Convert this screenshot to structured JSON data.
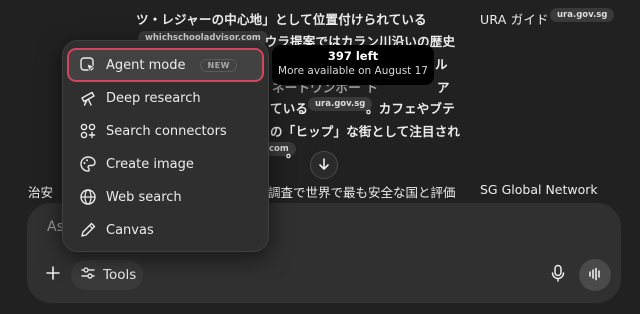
{
  "background": {
    "lines": [
      "ツ・レジャーの中心地」として位置付けられている",
      "。ウラ提案ではカラン川沿いの歴史",
      "ル",
      "ネートワンボー ト",
      "ア",
      "ている",
      "。カフェやブテ",
      "の「ヒップ」な街として注目され",
      "。"
    ],
    "chips": [
      "whichschooladvisor.com",
      "ura.gov.sg",
      "ura.gov.sg",
      "com"
    ],
    "right_source_label": "URA ガイド",
    "table_headers": [
      "治安",
      "調査で世界で最も安全な国と評価",
      "SG Global Network"
    ]
  },
  "tooltip": {
    "count_text": "397 left",
    "more_text": "More available on August 17"
  },
  "menu": {
    "items": [
      {
        "label": "Agent mode",
        "icon": "agent-mode-icon",
        "badge": "NEW",
        "active": true
      },
      {
        "label": "Deep research",
        "icon": "telescope-icon"
      },
      {
        "label": "Search connectors",
        "icon": "connectors-icon"
      },
      {
        "label": "Create image",
        "icon": "palette-icon"
      },
      {
        "label": "Web search",
        "icon": "globe-icon"
      },
      {
        "label": "Canvas",
        "icon": "pencil-icon"
      }
    ]
  },
  "composer": {
    "placeholder_visible": "As",
    "tools_label": "Tools",
    "icons": [
      "plus-icon",
      "sliders-icon",
      "microphone-icon",
      "voice-waveform-icon"
    ]
  },
  "colors": {
    "background": "#212121",
    "composer": "#303030",
    "menu": "#2f2f2f",
    "highlight_outline": "#d2455e"
  }
}
